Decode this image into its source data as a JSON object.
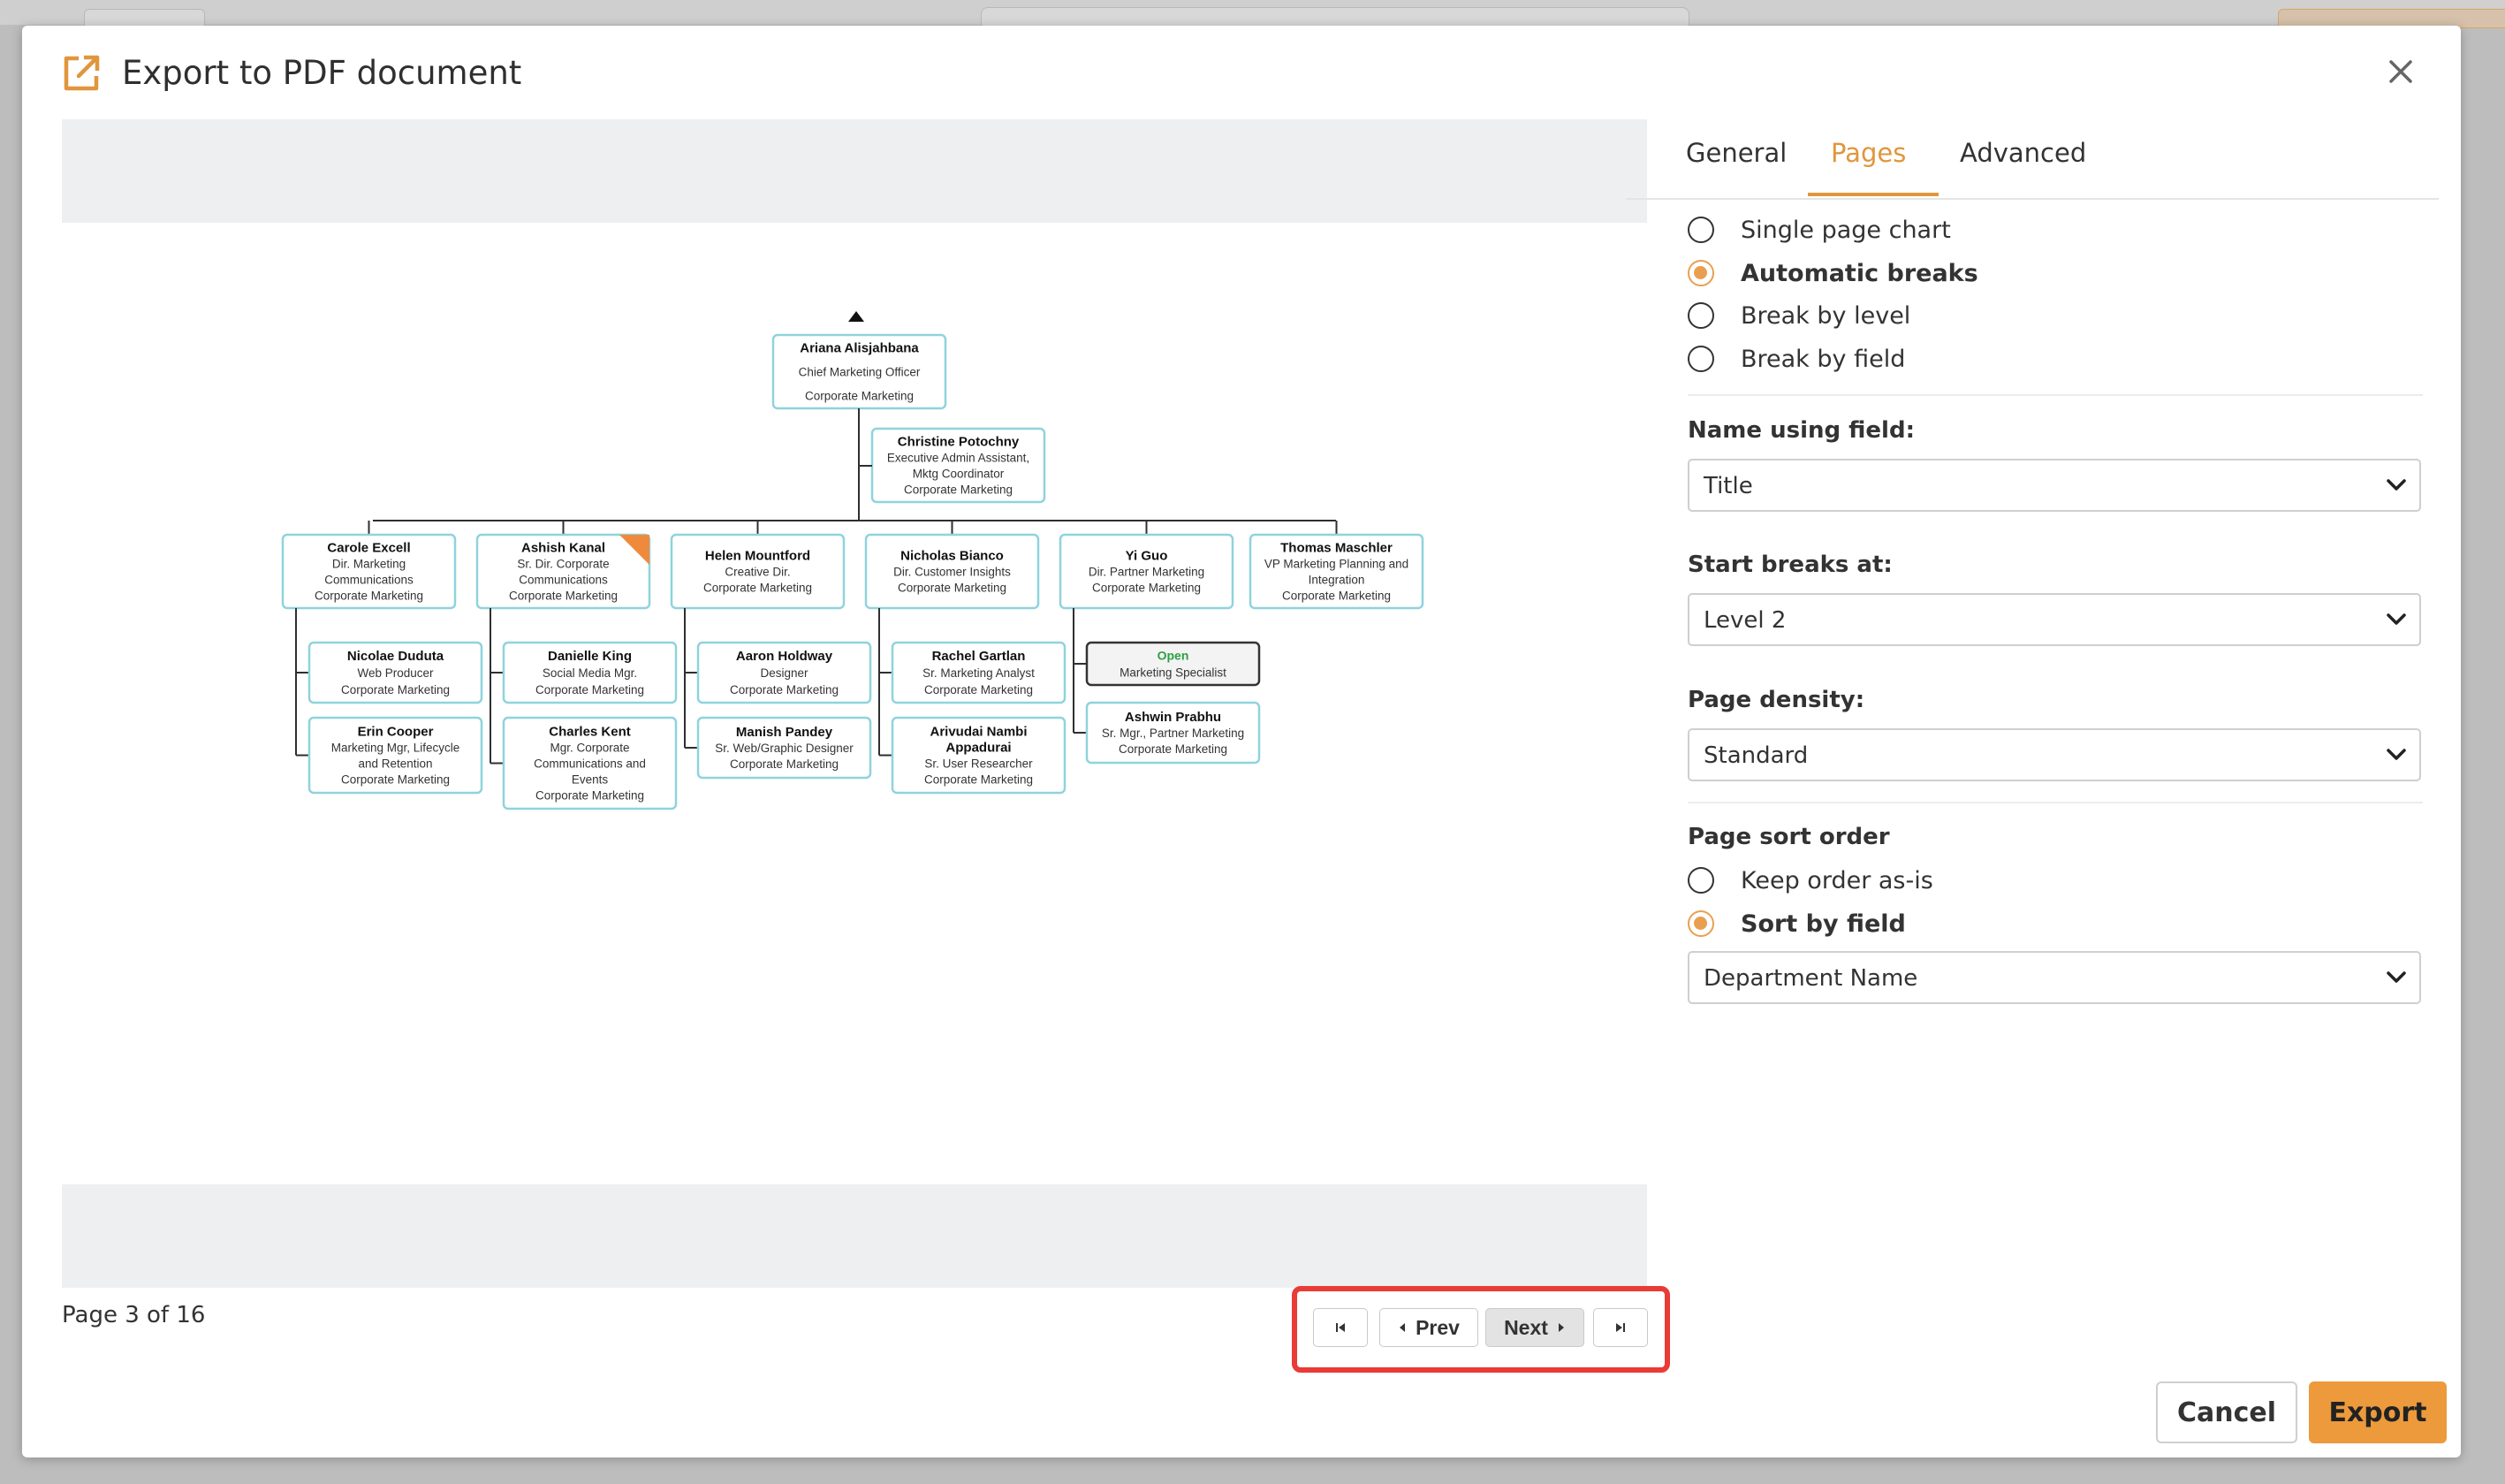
{
  "dialog": {
    "title": "Export to PDF document",
    "close_icon": "close-icon",
    "export_icon": "external-link-icon"
  },
  "tabs": [
    {
      "label": "General",
      "active": false
    },
    {
      "label": "Pages",
      "active": true
    },
    {
      "label": "Advanced",
      "active": false
    }
  ],
  "page_mode": {
    "options": [
      {
        "label": "Single page chart",
        "checked": false
      },
      {
        "label": "Automatic breaks",
        "checked": true
      },
      {
        "label": "Break by level",
        "checked": false
      },
      {
        "label": "Break by field",
        "checked": false
      }
    ]
  },
  "name_using_field": {
    "label": "Name using field:",
    "value": "Title"
  },
  "start_breaks_at": {
    "label": "Start breaks at:",
    "value": "Level 2"
  },
  "page_density": {
    "label": "Page density:",
    "value": "Standard"
  },
  "page_sort_order": {
    "label": "Page sort order",
    "options": [
      {
        "label": "Keep order as-is",
        "checked": false
      },
      {
        "label": "Sort by field",
        "checked": true
      }
    ],
    "field_value": "Department Name"
  },
  "pagination": {
    "info": "Page 3 of 16",
    "first_icon": "first-page-icon",
    "prev_label": "Prev",
    "next_label": "Next",
    "last_icon": "last-page-icon"
  },
  "footer": {
    "cancel_label": "Cancel",
    "export_label": "Export"
  },
  "colors": {
    "accent": "#ec9a3c",
    "node_border": "#8fd3dd",
    "highlight": "#ea3b36",
    "open_text": "#2ea043"
  },
  "org_chart": {
    "root": {
      "name": "Ariana Alisjahbana",
      "lines": [
        "Chief Marketing Officer",
        "Corporate Marketing"
      ]
    },
    "assistant": {
      "name": "Christine Potochny",
      "lines": [
        "Executive Admin Assistant,",
        "Mktg Coordinator",
        "Corporate Marketing"
      ]
    },
    "managers": [
      {
        "name": "Carole Excell",
        "lines": [
          "Dir. Marketing",
          "Communications",
          "Corporate Marketing"
        ]
      },
      {
        "name": "Ashish Kanal",
        "lines": [
          "Sr. Dir. Corporate",
          "Communications",
          "Corporate Marketing"
        ]
      },
      {
        "name": "Helen Mountford",
        "lines": [
          "Creative Dir.",
          "Corporate Marketing"
        ]
      },
      {
        "name": "Nicholas Bianco",
        "lines": [
          "Dir. Customer Insights",
          "Corporate Marketing"
        ]
      },
      {
        "name": "Yi Guo",
        "lines": [
          "Dir. Partner Marketing",
          "Corporate Marketing"
        ]
      },
      {
        "name": "Thomas Maschler",
        "lines": [
          "VP Marketing Planning and",
          "Integration",
          "Corporate Marketing"
        ]
      }
    ],
    "reports": [
      [
        {
          "name": "Nicolae Duduta",
          "lines": [
            "Web Producer",
            "Corporate Marketing"
          ]
        },
        {
          "name": "Erin Cooper",
          "lines": [
            "Marketing Mgr, Lifecycle",
            "and Retention",
            "Corporate Marketing"
          ]
        }
      ],
      [
        {
          "name": "Danielle King",
          "lines": [
            "Social Media Mgr.",
            "Corporate Marketing"
          ]
        },
        {
          "name": "Charles Kent",
          "lines": [
            "Mgr. Corporate",
            "Communications and",
            "Events",
            "Corporate Marketing"
          ]
        }
      ],
      [
        {
          "name": "Aaron Holdway",
          "lines": [
            "Designer",
            "Corporate Marketing"
          ]
        },
        {
          "name": "Manish Pandey",
          "lines": [
            "Sr. Web/Graphic Designer",
            "Corporate Marketing"
          ]
        }
      ],
      [
        {
          "name": "Rachel Gartlan",
          "lines": [
            "Sr. Marketing Analyst",
            "Corporate Marketing"
          ]
        },
        {
          "name": "Arivudai Nambi",
          "name2": "Appadurai",
          "lines": [
            "Sr. User Researcher",
            "Corporate Marketing"
          ]
        }
      ],
      [
        {
          "name": "Open",
          "lines": [
            "Marketing Specialist"
          ],
          "open": true
        },
        {
          "name": "Ashwin Prabhu",
          "lines": [
            "Sr. Mgr., Partner Marketing",
            "Corporate Marketing"
          ]
        }
      ]
    ]
  }
}
